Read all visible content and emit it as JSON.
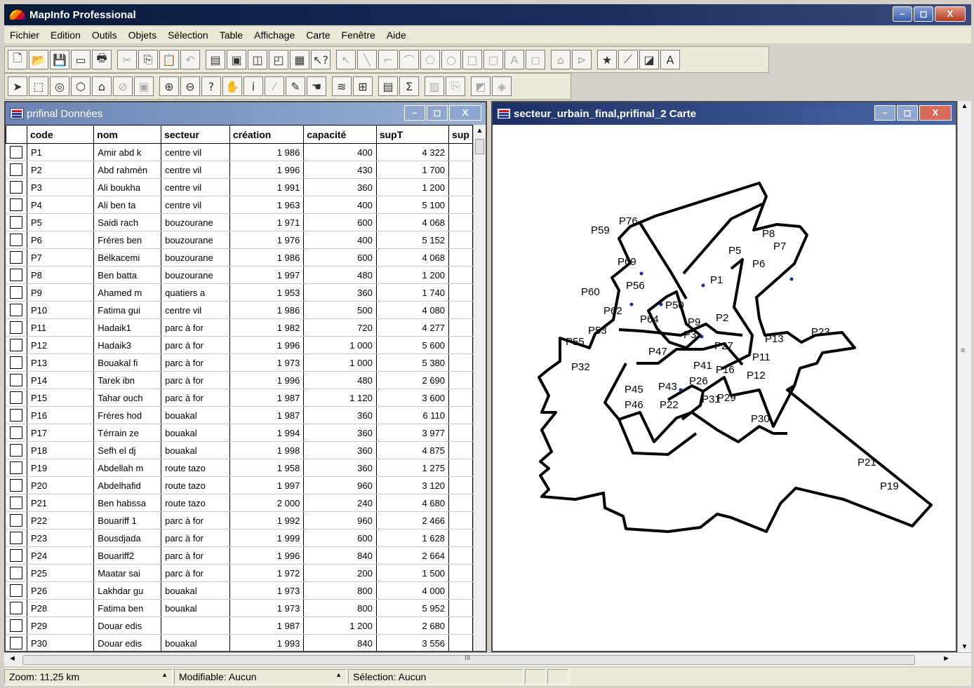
{
  "app": {
    "title": "MapInfo Professional",
    "min": "–",
    "max": "◻",
    "close": "X"
  },
  "menu": [
    "Fichier",
    "Edition",
    "Outils",
    "Objets",
    "Sélection",
    "Table",
    "Affichage",
    "Carte",
    "Fenêtre",
    "Aide"
  ],
  "toolbar1": [
    "new-file-icon",
    "open-folder-icon",
    "save-icon",
    "close-window-icon",
    "print-icon",
    "cut-icon",
    "copy-icon",
    "paste-icon",
    "undo-icon",
    "new-browser-icon",
    "new-map-icon",
    "new-graph-icon",
    "new-layout-icon",
    "new-redistrict-icon",
    "help-pointer-icon",
    "line-style-icon",
    "line-icon",
    "polyline-icon",
    "arc-icon",
    "polygon-icon",
    "ellipse-icon",
    "rectangle-icon",
    "rounded-rectangle-icon",
    "text-icon",
    "frame-icon",
    "reshape-icon",
    "add-node-icon",
    "symbol-style-icon",
    "line-style2-icon",
    "region-style-icon",
    "text-style-icon"
  ],
  "toolbar2": [
    "select-icon",
    "marquee-select-icon",
    "radius-select-icon",
    "polygon-select-icon",
    "boundary-select-icon",
    "unselect-all-icon",
    "graph-select-icon",
    "zoom-in-icon",
    "zoom-out-icon",
    "change-view-icon",
    "grabber-icon",
    "info-icon",
    "ruler-icon",
    "label-icon",
    "drag-map-icon",
    "layer-control-icon",
    "legend-icon",
    "statistics-icon",
    "sum-icon",
    "thematic-map-icon",
    "hotlink-icon",
    "clip-region-icon",
    "set-target-icon"
  ],
  "data_window": {
    "title": "prifinal Données",
    "columns": [
      "code",
      "nom",
      "secteur",
      "création",
      "capacité",
      "supT",
      "sup"
    ],
    "rows": [
      [
        "P1",
        "Amir abd k",
        "centre vil",
        "1 986",
        "400",
        "4 322"
      ],
      [
        "P2",
        "Abd rahmén",
        "centre vil",
        "1 996",
        "430",
        "1 700"
      ],
      [
        "P3",
        "Ali boukha",
        "centre vil",
        "1 991",
        "360",
        "1 200"
      ],
      [
        "P4",
        "Ali ben ta",
        "centre vil",
        "1 963",
        "400",
        "5 100"
      ],
      [
        "P5",
        "Saidi rach",
        "bouzourane",
        "1 971",
        "600",
        "4 068"
      ],
      [
        "P6",
        "Fréres ben",
        "bouzourane",
        "1 976",
        "400",
        "5 152"
      ],
      [
        "P7",
        "Belkacemi",
        "bouzourane",
        "1 986",
        "600",
        "4 068"
      ],
      [
        "P8",
        "Ben batta",
        "bouzourane",
        "1 997",
        "480",
        "1 200"
      ],
      [
        "P9",
        "Ahamed m",
        "quatiers a",
        "1 953",
        "360",
        "1 740"
      ],
      [
        "P10",
        "Fatima gui",
        "centre vil",
        "1 986",
        "500",
        "4 080"
      ],
      [
        "P11",
        "Hadaik1",
        "parc à for",
        "1 982",
        "720",
        "4 277"
      ],
      [
        "P12",
        "Hadaik3",
        "parc à for",
        "1 996",
        "1 000",
        "5 600"
      ],
      [
        "P13",
        "Bouakal fi",
        "parc à for",
        "1 973",
        "1 000",
        "5 380"
      ],
      [
        "P14",
        "Tarek ibn",
        "parc à for",
        "1 996",
        "480",
        "2 690"
      ],
      [
        "P15",
        "Tahar ouch",
        "parc à for",
        "1 987",
        "1 120",
        "3 600"
      ],
      [
        "P16",
        "Fréres hod",
        "bouakal",
        "1 987",
        "360",
        "6 110"
      ],
      [
        "P17",
        "Térrain ze",
        "bouakal",
        "1 994",
        "360",
        "3 977"
      ],
      [
        "P18",
        "Sefh el dj",
        "bouakal",
        "1 998",
        "360",
        "4 875"
      ],
      [
        "P19",
        "Abdellah m",
        "route tazo",
        "1 958",
        "360",
        "1 275"
      ],
      [
        "P20",
        "Abdelhafid",
        "route tazo",
        "1 997",
        "960",
        "3 120"
      ],
      [
        "P21",
        "Ben habssa",
        "route tazo",
        "2 000",
        "240",
        "4 680"
      ],
      [
        "P22",
        "Bouariff 1",
        "parc à for",
        "1 992",
        "960",
        "2 466"
      ],
      [
        "P23",
        "Bousdjada",
        "parc à for",
        "1 999",
        "600",
        "1 628"
      ],
      [
        "P24",
        "Bouariff2",
        "parc à for",
        "1 996",
        "840",
        "2 664"
      ],
      [
        "P25",
        "Maatar sai",
        "parc à for",
        "1 972",
        "200",
        "1 500"
      ],
      [
        "P26",
        "Lakhdar gu",
        "bouakal",
        "1 973",
        "800",
        "4 000"
      ],
      [
        "P28",
        "Fatima ben",
        "bouakal",
        "1 973",
        "800",
        "5 952"
      ],
      [
        "P29",
        "Douar edis",
        "",
        "1 987",
        "1 200",
        "2 680"
      ],
      [
        "P30",
        "Douar edis",
        "bouakal",
        "1 993",
        "840",
        "3 556"
      ]
    ]
  },
  "map_window": {
    "title": "secteur_urbain_final,prifinal_2 Carte",
    "labels": [
      "P59",
      "P76",
      "P8",
      "P7",
      "P5",
      "P6",
      "P69",
      "P1",
      "P60",
      "P56",
      "P50",
      "P62",
      "P64",
      "P53",
      "P13",
      "P23",
      "P55",
      "P47",
      "P27",
      "P11",
      "P32",
      "P41",
      "P16",
      "P12",
      "P26",
      "P45",
      "P43",
      "P46",
      "P22",
      "P31",
      "P29",
      "P30",
      "P21",
      "P19",
      "P3",
      "P9",
      "P2"
    ]
  },
  "scrollbar": {
    "left": "◄",
    "right": "►",
    "grip": "III",
    "up": "▲",
    "down": "▼",
    "vgrip": "≡"
  },
  "status": {
    "zoom": "Zoom: 11,25 km",
    "editable": "Modifiable: Aucun",
    "selection": "Sélection: Aucun",
    "caret": "▲"
  }
}
